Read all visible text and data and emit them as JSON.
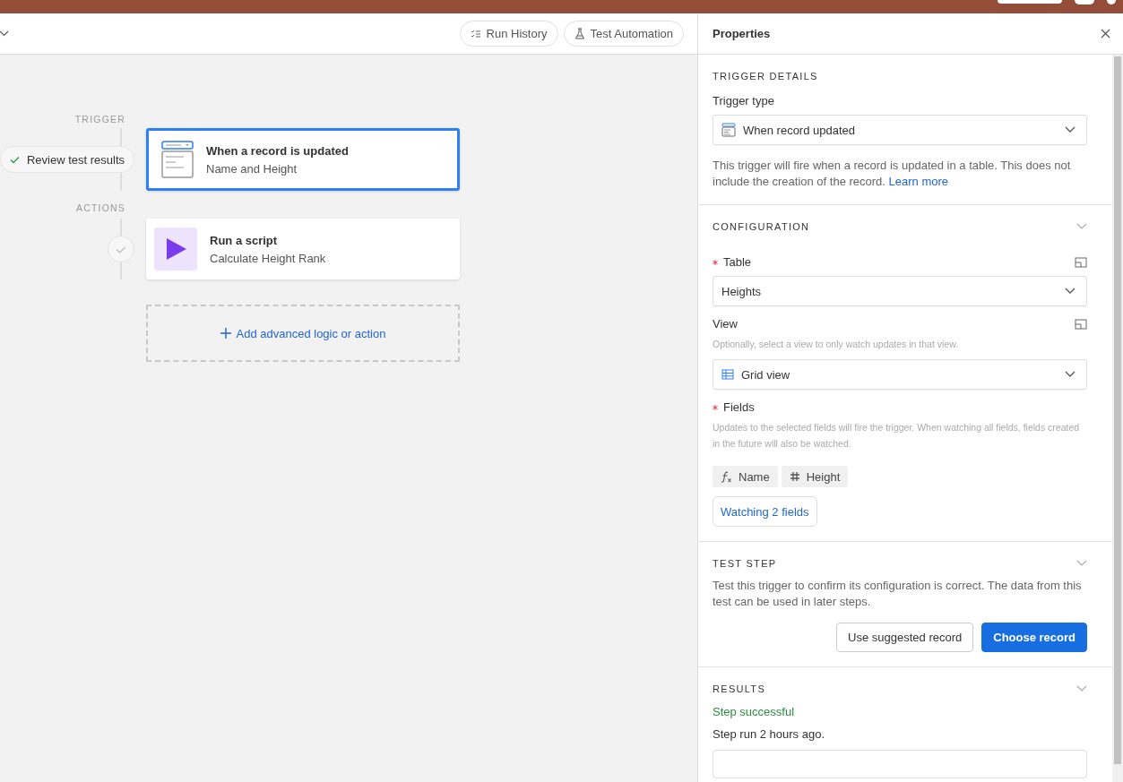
{
  "toolbar": {
    "buttons": [
      {
        "kind": "history",
        "label": "Run History"
      },
      {
        "kind": "flask",
        "label": "Test Automation"
      }
    ]
  },
  "canvas": {
    "review_button": "Review test results",
    "stages": [
      {
        "label": "TRIGGER",
        "steps": [
          {
            "kind": "record",
            "title": "When a record is updated",
            "subtitle": "Name and Height",
            "selected": true,
            "done": false
          }
        ]
      },
      {
        "label": "ACTIONS",
        "steps": [
          {
            "kind": "script",
            "title": "Run a script",
            "subtitle": "Calculate Height Rank",
            "selected": false,
            "done": true
          }
        ]
      }
    ],
    "add_button": "Add advanced logic or action"
  },
  "properties": {
    "title": "Properties",
    "sections": [
      {
        "kind": "details",
        "title": "TRIGGER DETAILS",
        "collapsible": false,
        "label": "Trigger type",
        "select": "When record updated",
        "description": "This trigger will fire when a record is updated in a table. This does not include the creation of the record.",
        "link": "Learn more"
      },
      {
        "kind": "config",
        "title": "CONFIGURATION",
        "collapsible": true,
        "fields": [
          {
            "kind": "table-select",
            "label": "Table",
            "required": true,
            "value": "Heights"
          },
          {
            "kind": "view-select",
            "label": "View",
            "required": false,
            "hint": "Optionally, select a view to only watch updates in that view.",
            "value": "Grid view"
          },
          {
            "kind": "chips",
            "label": "Fields",
            "required": true,
            "hint": "Updates to the selected fields will fire the trigger. When watching all fields, fields created in the future will also be watched.",
            "chips": [
              {
                "kind": "formula",
                "label": "Name"
              },
              {
                "kind": "number",
                "label": "Height"
              }
            ],
            "button": "Watching 2 fields"
          }
        ]
      },
      {
        "kind": "test",
        "title": "TEST STEP",
        "collapsible": true,
        "description": "Test this trigger to confirm its configuration is correct. The data from this test can be used in later steps.",
        "buttons": [
          {
            "label": "Use suggested record",
            "primary": false
          },
          {
            "label": "Choose record",
            "primary": true
          }
        ]
      },
      {
        "kind": "results",
        "title": "RESULTS",
        "collapsible": true,
        "status": "Step successful",
        "time": "Step run 2 hours ago."
      }
    ]
  }
}
